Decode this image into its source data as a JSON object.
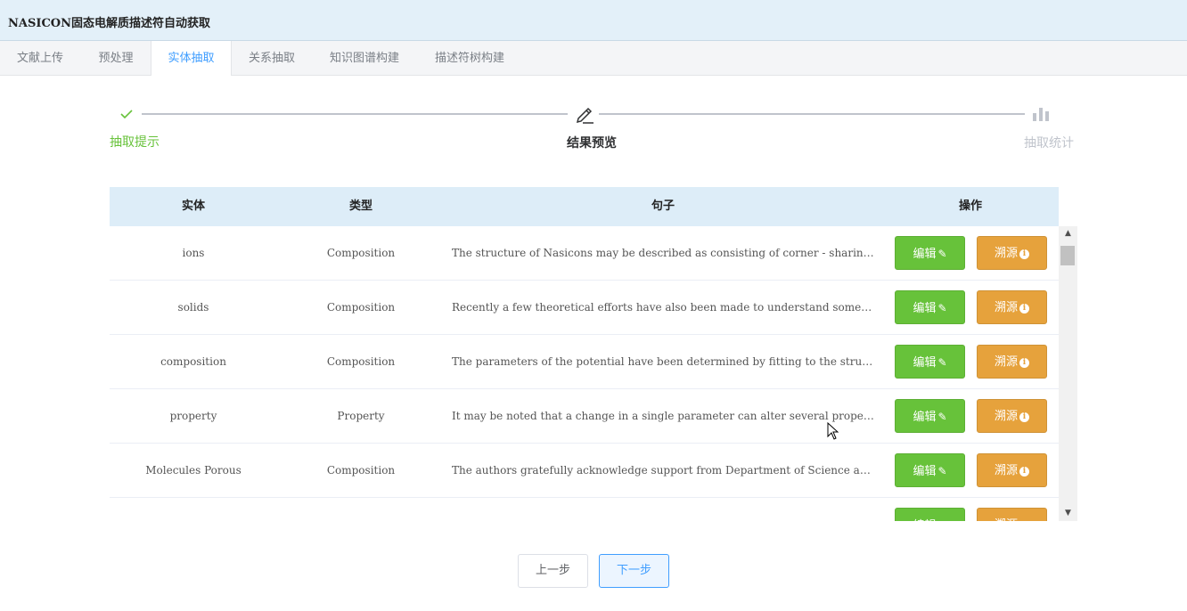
{
  "app": {
    "title": "NASICON固态电解质描述符自动获取"
  },
  "tabs": [
    {
      "label": "文献上传"
    },
    {
      "label": "预处理"
    },
    {
      "label": "实体抽取"
    },
    {
      "label": "关系抽取"
    },
    {
      "label": "知识图谱构建"
    },
    {
      "label": "描述符树构建"
    }
  ],
  "active_tab": "实体抽取",
  "steps": [
    {
      "label": "抽取提示",
      "status": "done",
      "icon": "check-icon"
    },
    {
      "label": "结果预览",
      "status": "current",
      "icon": "edit-icon"
    },
    {
      "label": "抽取统计",
      "status": "pending",
      "icon": "bar-chart-icon"
    }
  ],
  "table": {
    "headers": {
      "entity": "实体",
      "type": "类型",
      "sentence": "句子",
      "action": "操作"
    },
    "edit_label": "编辑",
    "trace_label": "溯源",
    "rows": [
      {
        "entity": "ions",
        "type": "Composition",
        "sentence": "The structure of Nasicons may be described as consisting of corner - sharing POY / Si..."
      },
      {
        "entity": "solids",
        "type": "Composition",
        "sentence": "Recently a few theoretical efforts have also been made to understand some of these asp..."
      },
      {
        "entity": "composition",
        "type": "Composition",
        "sentence": "The parameters of the potential have been determined by fitting to the structure and co..."
      },
      {
        "entity": "property",
        "type": "Property",
        "sentence": "It may be noted that a change in a single parameter can alter several properties and adj..."
      },
      {
        "entity": "Molecules Porous",
        "type": "Composition",
        "sentence": "The authors gratefully acknowledge support from Department of Science and Technolo..."
      },
      {
        "entity": "",
        "type": "",
        "sentence": ""
      }
    ]
  },
  "buttons": {
    "prev": "上一步",
    "next": "下一步"
  },
  "colors": {
    "header_bg": "#e3f0f9",
    "table_header_bg": "#ddedf8",
    "success": "#67c23a",
    "warning": "#e6a23c",
    "primary": "#409eff"
  }
}
